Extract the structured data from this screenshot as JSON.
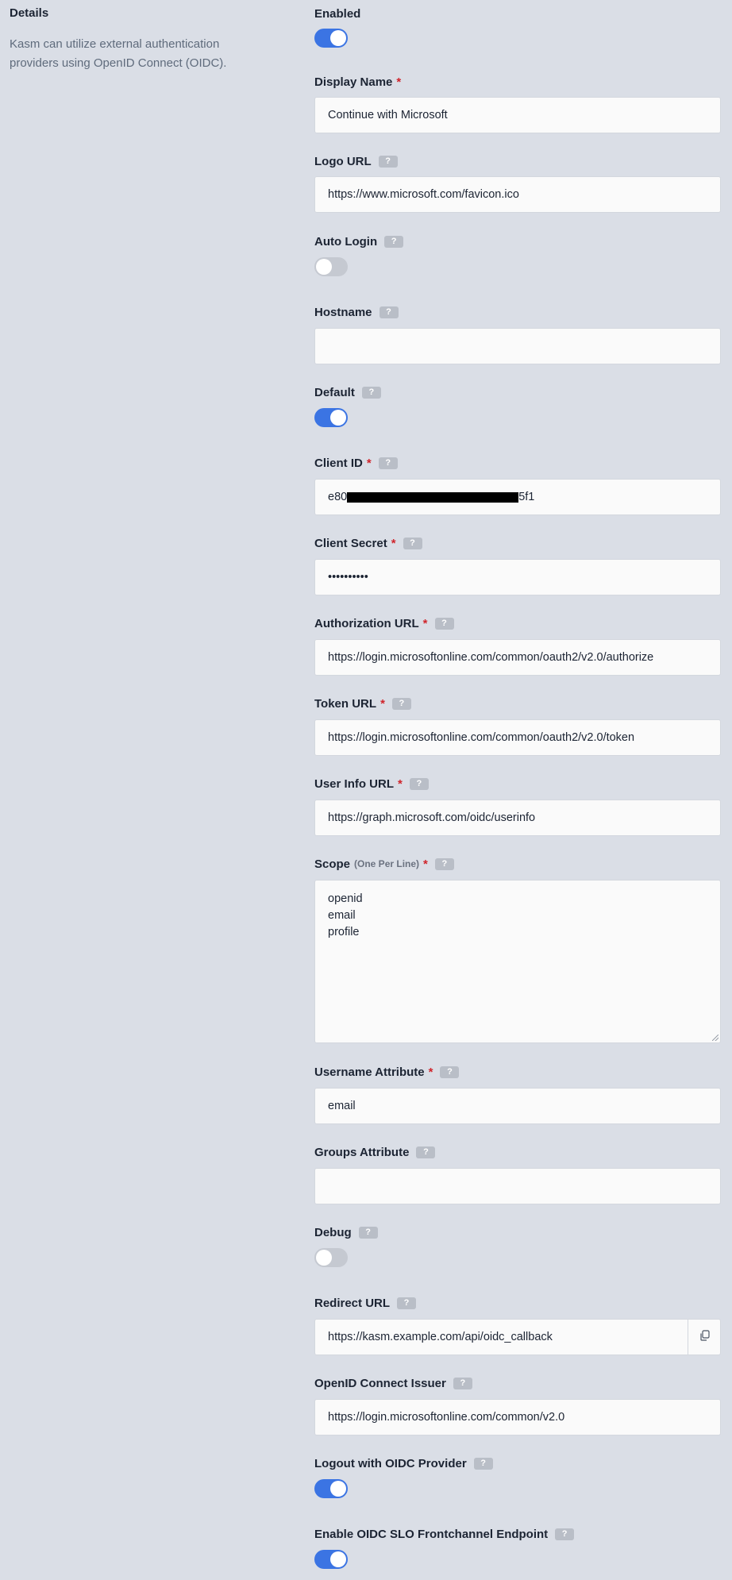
{
  "sidebar": {
    "title": "Details",
    "description": "Kasm can utilize external authentication providers using OpenID Connect (OIDC)."
  },
  "help_symbol": "?",
  "required_marker": "*",
  "form": {
    "enabled": {
      "label": "Enabled",
      "value": true
    },
    "display_name": {
      "label": "Display Name",
      "value": "Continue with Microsoft"
    },
    "logo_url": {
      "label": "Logo URL",
      "value": "https://www.microsoft.com/favicon.ico"
    },
    "auto_login": {
      "label": "Auto Login",
      "value": false
    },
    "hostname": {
      "label": "Hostname",
      "value": ""
    },
    "default": {
      "label": "Default",
      "value": true
    },
    "client_id": {
      "label": "Client ID",
      "value_prefix": "e80",
      "value_suffix": "5f1"
    },
    "client_secret": {
      "label": "Client Secret",
      "value": "••••••••••"
    },
    "authorization_url": {
      "label": "Authorization URL",
      "value": "https://login.microsoftonline.com/common/oauth2/v2.0/authorize"
    },
    "token_url": {
      "label": "Token URL",
      "value": "https://login.microsoftonline.com/common/oauth2/v2.0/token"
    },
    "user_info_url": {
      "label": "User Info URL",
      "value": "https://graph.microsoft.com/oidc/userinfo"
    },
    "scope": {
      "label": "Scope",
      "hint": "(One Per Line)",
      "lines": [
        "openid",
        "email",
        "profile"
      ]
    },
    "username_attribute": {
      "label": "Username Attribute",
      "value": "email"
    },
    "groups_attribute": {
      "label": "Groups Attribute",
      "value": ""
    },
    "debug": {
      "label": "Debug",
      "value": false
    },
    "redirect_url": {
      "label": "Redirect URL",
      "value": "https://kasm.example.com/api/oidc_callback"
    },
    "openid_issuer": {
      "label": "OpenID Connect Issuer",
      "value": "https://login.microsoftonline.com/common/v2.0"
    },
    "logout_with_oidc": {
      "label": "Logout with OIDC Provider",
      "value": true
    },
    "oidc_slo_frontchannel": {
      "label": "Enable OIDC SLO Frontchannel Endpoint",
      "value": true
    }
  },
  "colors": {
    "background": "#dadee6",
    "toggle_on": "#3b74e3",
    "toggle_off": "#c5c9d1",
    "required": "#d0242b"
  }
}
